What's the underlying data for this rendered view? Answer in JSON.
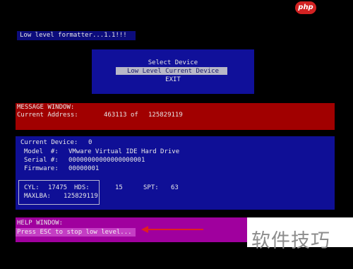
{
  "watermark": {
    "logo": "php",
    "text": "软件技巧"
  },
  "title_bar": {
    "text": "Low level formatter...1.1!!!"
  },
  "menu": {
    "items": [
      "Select Device",
      "Low Level Current Device",
      "EXIT"
    ],
    "selected_index": 1
  },
  "message_window": {
    "heading": "MESSAGE WINDOW:",
    "address_label": "Current Address:",
    "address_value": "463113",
    "of_label": "of",
    "total_value": "125829119"
  },
  "device": {
    "current_label": "Current Device:",
    "current_value": "0",
    "model_label": "Model  #:",
    "model_value": "VMware Virtual IDE Hard Drive",
    "serial_label": "Serial #:",
    "serial_value": "00000000000000000001",
    "firmware_label": "Firmware:",
    "firmware_value": "00000001",
    "cyl_label": "CYL:",
    "cyl_value": "17475",
    "hds_label": "HDS:",
    "hds_value": "15",
    "spt_label": "SPT:",
    "spt_value": "63",
    "maxlba_label": "MAXLBA:",
    "maxlba_value": "125829119"
  },
  "help_window": {
    "heading": "HELP WINDOW:",
    "text": "Press ESC to stop low level..."
  },
  "colors": {
    "background": "#000000",
    "menu_blue": "#10109a",
    "message_red": "#a10000",
    "device_blue": "#0f0f96",
    "help_magenta": "#a0009e",
    "highlight_gray": "#b8b8c8",
    "arrow_red": "#e02020"
  }
}
